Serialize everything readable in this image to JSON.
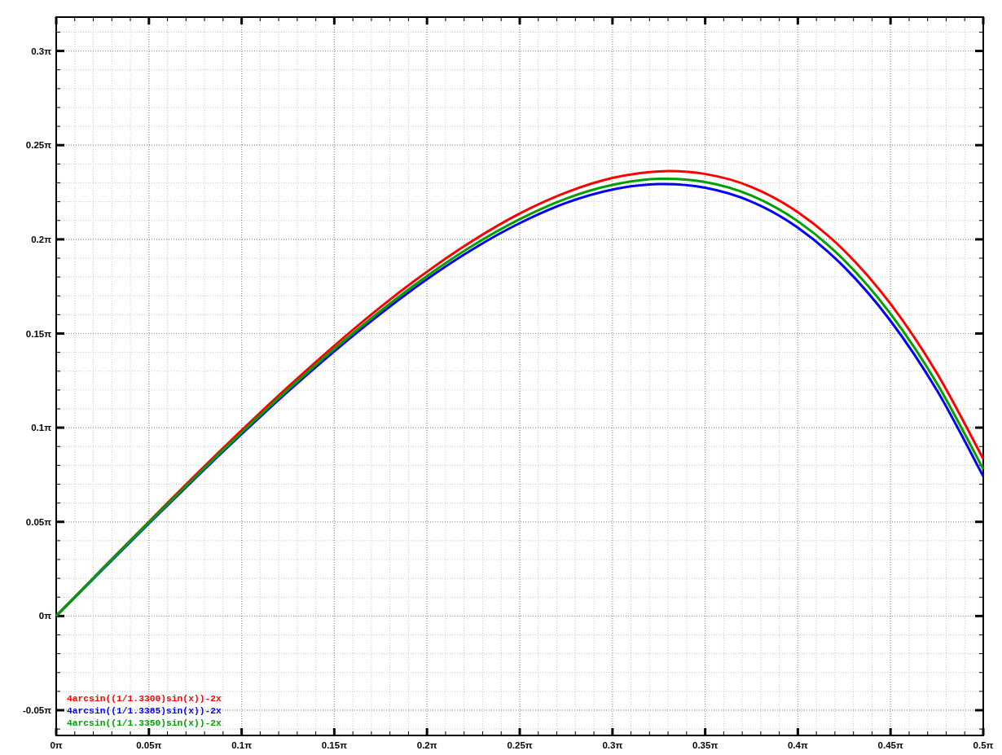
{
  "plot": {
    "chart_data": {
      "type": "line",
      "x": [
        0,
        0.0785,
        0.1571,
        0.2356,
        0.3142,
        0.3927,
        0.4712,
        0.5498,
        0.6283,
        0.7069,
        0.7854,
        0.8639,
        0.9425,
        1.021,
        1.0996,
        1.1781,
        1.2566,
        1.3352,
        1.4137,
        1.4923,
        1.5708
      ],
      "series": [
        {
          "name": "4arcsin((1/1.3300)sin(x))-2x",
          "color": "#ff0000",
          "values": [
            0,
            0.0792,
            0.1574,
            0.2347,
            0.3098,
            0.382,
            0.4508,
            0.5155,
            0.5743,
            0.6267,
            0.6714,
            0.7065,
            0.7307,
            0.7417,
            0.7373,
            0.7157,
            0.6736,
            0.6095,
            0.5206,
            0.405,
            0.262
          ]
        },
        {
          "name": "4arcsin((1/1.3385)sin(x))-2x",
          "color": "#0000ff",
          "values": [
            0,
            0.0776,
            0.1546,
            0.23,
            0.3035,
            0.3745,
            0.4417,
            0.5045,
            0.562,
            0.6126,
            0.6553,
            0.689,
            0.7113,
            0.7204,
            0.7144,
            0.6912,
            0.6478,
            0.5821,
            0.4923,
            0.3764,
            0.2331
          ]
        },
        {
          "name": "4arcsin((1/1.3350)sin(x))-2x",
          "color": "#00a000",
          "values": [
            0,
            0.0782,
            0.1558,
            0.2318,
            0.306,
            0.3776,
            0.4455,
            0.5089,
            0.5671,
            0.6186,
            0.6619,
            0.6962,
            0.7191,
            0.7292,
            0.7238,
            0.7012,
            0.6585,
            0.5934,
            0.5039,
            0.388,
            0.245
          ]
        }
      ],
      "grid": true,
      "xlim": [
        0,
        1.5708
      ],
      "ylim": [
        -0.1992,
        0.999
      ],
      "xticks": [
        {
          "value": 0,
          "label": "0π"
        },
        {
          "value": 0.1571,
          "label": "0.05π"
        },
        {
          "value": 0.3142,
          "label": "0.1π"
        },
        {
          "value": 0.4712,
          "label": "0.15π"
        },
        {
          "value": 0.6283,
          "label": "0.2π"
        },
        {
          "value": 0.7854,
          "label": "0.25π"
        },
        {
          "value": 0.9425,
          "label": "0.3π"
        },
        {
          "value": 1.0996,
          "label": "0.35π"
        },
        {
          "value": 1.2566,
          "label": "0.4π"
        },
        {
          "value": 1.4137,
          "label": "0.45π"
        },
        {
          "value": 1.5708,
          "label": "0.5π"
        }
      ],
      "yticks": [
        {
          "value": -0.1571,
          "label": "-0.05π"
        },
        {
          "value": 0,
          "label": "0π"
        },
        {
          "value": 0.1571,
          "label": "0.05π"
        },
        {
          "value": 0.3142,
          "label": "0.1π"
        },
        {
          "value": 0.4712,
          "label": "0.15π"
        },
        {
          "value": 0.6283,
          "label": "0.2π"
        },
        {
          "value": 0.7854,
          "label": "0.25π"
        },
        {
          "value": 0.9425,
          "label": "0.3π"
        }
      ]
    }
  }
}
